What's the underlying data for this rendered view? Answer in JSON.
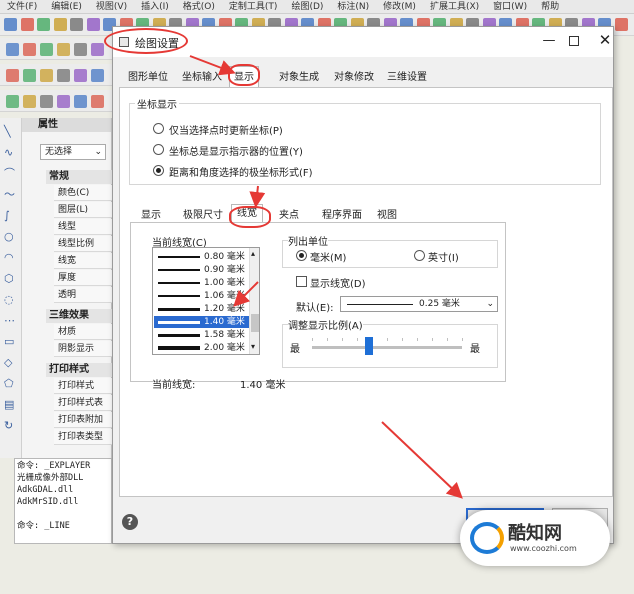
{
  "menubar": {
    "items": [
      "文件(F)",
      "编辑(E)",
      "视图(V)",
      "插入(I)",
      "格式(O)",
      "定制工具(T)",
      "绘图(D)",
      "标注(N)",
      "修改(M)",
      "扩展工具(X)",
      "窗口(W)",
      "帮助"
    ]
  },
  "properties": {
    "title": "属性",
    "selector": "无选择",
    "sections": [
      {
        "name": "常规",
        "rows": [
          "颜色(C)",
          "图层(L)",
          "线型",
          "线型比例",
          "线宽",
          "厚度",
          "透明"
        ]
      },
      {
        "name": "三维效果",
        "rows": [
          "材质",
          "阴影显示"
        ]
      },
      {
        "name": "打印样式",
        "rows": [
          "打印样式",
          "打印样式表",
          "打印表附加",
          "打印表类型"
        ]
      }
    ]
  },
  "command": {
    "lines": [
      "命令:  _EXPLAYER",
      "光栅成像外部DLL",
      "AdkGDAL.dll",
      "AdkMrSID.dll"
    ],
    "prompt": "命令:  _LINE"
  },
  "dialog": {
    "title": "绘图设置",
    "tabs": [
      "图形单位",
      "坐标输入",
      "显示",
      "对象生成",
      "对象修改",
      "三维设置"
    ],
    "coord_group": {
      "title": "坐标显示",
      "options": [
        "仅当选择点时更新坐标(P)",
        "坐标总是显示指示器的位置(Y)",
        "距离和角度选择的极坐标形式(F)"
      ],
      "selected": 2
    },
    "subtabs": [
      "显示",
      "极限尺寸",
      "线宽",
      "夹点",
      "程序界面",
      "视图"
    ],
    "lineweight": {
      "list_label": "当前线宽(C)",
      "items": [
        "0.80 毫米",
        "0.90 毫米",
        "1.00 毫米",
        "1.06 毫米",
        "1.20 毫米",
        "1.40 毫米",
        "1.58 毫米",
        "2.00 毫米"
      ],
      "selected": 5,
      "units_title": "列出单位",
      "unit_mm": "毫米(M)",
      "unit_in": "英寸(I)",
      "display_lw": "显示线宽(D)",
      "default_label": "默认(E):",
      "default_value": "0.25 毫米",
      "scale_title": "调整显示比例(A)",
      "scale_min": "最",
      "scale_max": "最",
      "scale_level": 0.38,
      "current_label": "当前线宽:",
      "current_value": "1.40 毫米"
    },
    "help": "?"
  },
  "watermark": {
    "brand": "酷知网",
    "url": "www.coozhi.com"
  },
  "colors": {
    "accent": "#2a6ad0",
    "marker": "#e53935"
  }
}
